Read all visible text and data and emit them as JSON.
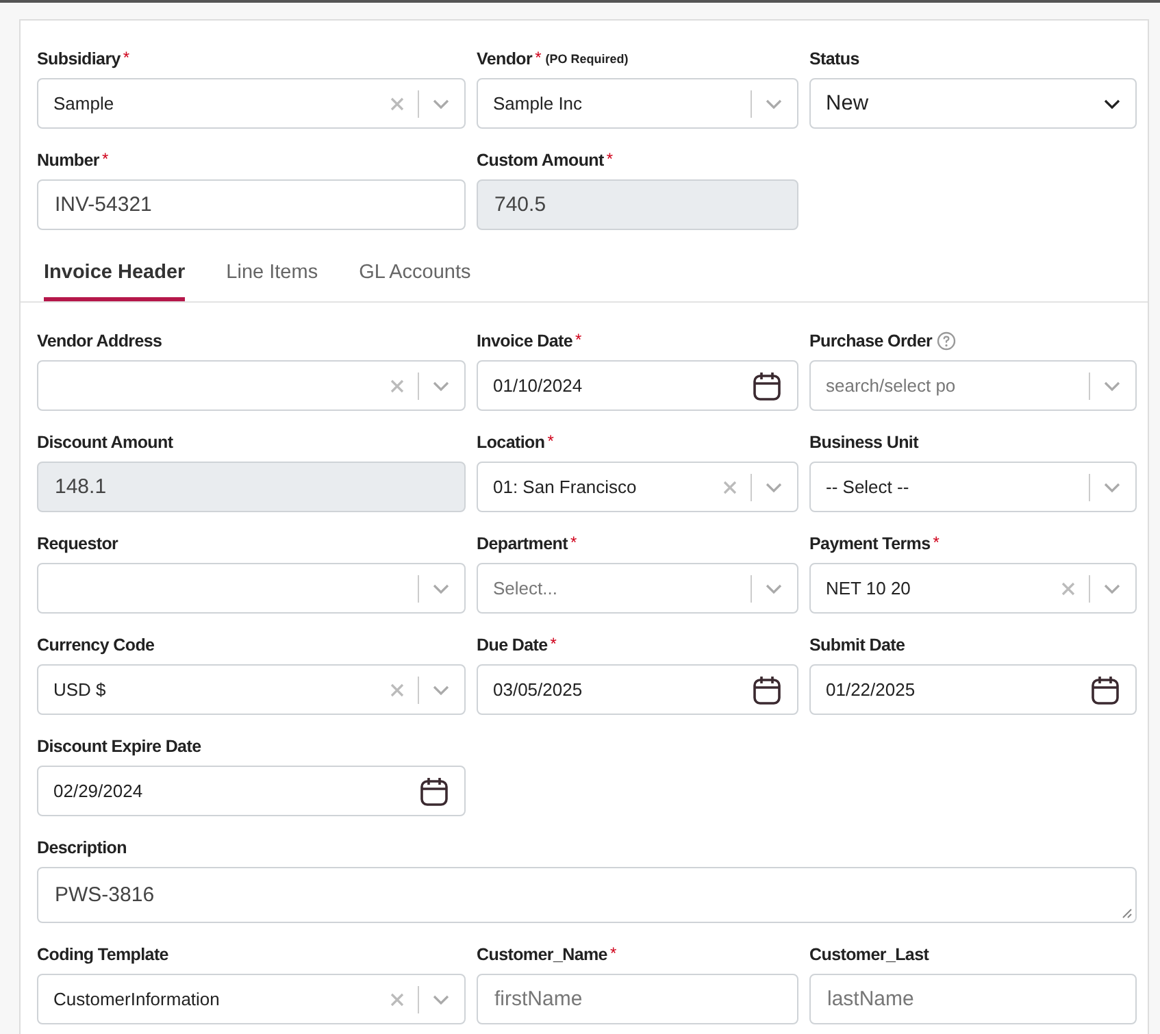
{
  "top_rows": [
    [
      {
        "label": "Subsidiary",
        "mark": "*",
        "kind": "combo",
        "value": "Sample",
        "clearable": true
      },
      {
        "label": "Vendor",
        "mark": "*",
        "note": "(PO Required)",
        "kind": "combo",
        "value": "Sample Inc",
        "clearable": false
      },
      {
        "label": "Status",
        "kind": "select",
        "value": "New"
      }
    ],
    [
      {
        "label": "Number",
        "mark": "*",
        "kind": "text",
        "value": "INV-54321",
        "disabled": false
      },
      {
        "label": "Custom Amount",
        "mark": "*",
        "kind": "text",
        "value": "740.5",
        "disabled": true
      }
    ]
  ],
  "tabs": [
    {
      "label": "Invoice Header",
      "selected": true
    },
    {
      "label": "Line Items",
      "selected": false
    },
    {
      "label": "GL Accounts",
      "selected": false
    }
  ],
  "rows": [
    [
      {
        "label": "Vendor Address",
        "kind": "combo",
        "clearable": true
      },
      {
        "label": "Invoice Date",
        "mark": "*",
        "kind": "date",
        "value": "01/10/2024"
      },
      {
        "label": "Purchase Order",
        "help": true,
        "kind": "combo",
        "placeholder": "search/select po",
        "clearable": false
      }
    ],
    [
      {
        "label": "Discount Amount",
        "kind": "text",
        "value": "148.1",
        "disabled": true
      },
      {
        "label": "Location",
        "mark": "*",
        "kind": "combo",
        "value": "01: San Francisco",
        "clearable": true
      },
      {
        "label": "Business Unit",
        "kind": "combo",
        "value": "-- Select --",
        "clearable": false
      }
    ],
    [
      {
        "label": "Requestor",
        "kind": "combo",
        "clearable": false
      },
      {
        "label": "Department",
        "mark": "*",
        "kind": "combo",
        "placeholder": "Select...",
        "clearable": false
      },
      {
        "label": "Payment Terms",
        "mark": "*",
        "kind": "combo",
        "value": "NET 10 20",
        "clearable": true
      }
    ],
    [
      {
        "label": "Currency Code",
        "kind": "combo",
        "value": "USD $",
        "clearable": true
      },
      {
        "label": "Due Date",
        "mark": "*",
        "kind": "date",
        "value": "03/05/2025"
      },
      {
        "label": "Submit Date",
        "kind": "date",
        "value": "01/22/2025"
      }
    ],
    [
      {
        "label": "Discount Expire Date",
        "kind": "date",
        "value": "02/29/2024"
      }
    ],
    [
      {
        "label": "Description",
        "kind": "textarea",
        "value": "PWS-3816"
      }
    ],
    [
      {
        "label": "Coding Template",
        "kind": "combo",
        "value": "CustomerInformation",
        "clearable": true
      },
      {
        "label": "Customer_Name",
        "mark": "*",
        "kind": "text",
        "placeholder": "firstName",
        "disabled": false
      },
      {
        "label": "Customer_Last",
        "kind": "text",
        "placeholder": "lastName",
        "disabled": false
      }
    ]
  ]
}
